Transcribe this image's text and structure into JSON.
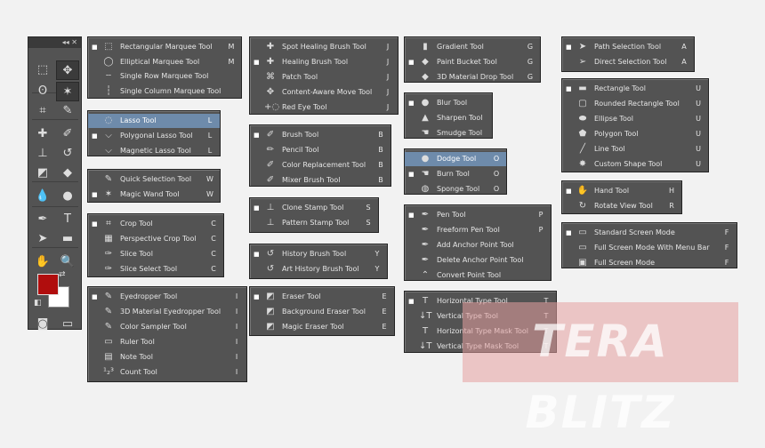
{
  "toolbar": {
    "header": "◂◂ ✕",
    "rows": [
      {
        "l": {
          "icon": "rect-marquee-icon",
          "glyph": "⬚"
        },
        "r": {
          "icon": "move-icon",
          "glyph": "✥",
          "active": true
        }
      },
      {
        "l": {
          "icon": "lasso-icon",
          "glyph": "ʘ"
        },
        "r": {
          "icon": "magic-wand-icon",
          "glyph": "✶",
          "active": true
        }
      },
      {
        "l": {
          "icon": "crop-icon",
          "glyph": "⌗"
        },
        "r": {
          "icon": "eyedropper-icon",
          "glyph": "✎"
        }
      },
      {
        "l": {
          "icon": "healing-brush-icon",
          "glyph": "✚"
        },
        "r": {
          "icon": "brush-icon",
          "glyph": "✐"
        }
      },
      {
        "l": {
          "icon": "clone-stamp-icon",
          "glyph": "⊥"
        },
        "r": {
          "icon": "history-brush-icon",
          "glyph": "↺"
        }
      },
      {
        "l": {
          "icon": "eraser-icon",
          "glyph": "◩"
        },
        "r": {
          "icon": "paint-bucket-icon",
          "glyph": "◆"
        }
      },
      {
        "l": {
          "icon": "blur-icon",
          "glyph": "💧"
        },
        "r": {
          "icon": "dodge-icon",
          "glyph": "●"
        }
      },
      {
        "l": {
          "icon": "pen-icon",
          "glyph": "✒"
        },
        "r": {
          "icon": "type-icon",
          "glyph": "T"
        }
      },
      {
        "l": {
          "icon": "path-selection-icon",
          "glyph": "➤"
        },
        "r": {
          "icon": "rectangle-shape-icon",
          "glyph": "▬"
        }
      },
      {
        "l": {
          "icon": "hand-icon",
          "glyph": "✋"
        },
        "r": {
          "icon": "zoom-icon",
          "glyph": "🔍"
        }
      }
    ],
    "bottom": {
      "l": {
        "icon": "quick-mask-icon",
        "glyph": "◙"
      },
      "r": {
        "icon": "screen-mode-icon",
        "glyph": "▭"
      }
    }
  },
  "menus": [
    {
      "id": "marquee",
      "items": [
        {
          "label": "Rectangular Marquee Tool",
          "key": "M",
          "icon": "rect-marquee-icon",
          "glyph": "⬚",
          "bullet": true
        },
        {
          "label": "Elliptical Marquee Tool",
          "key": "M",
          "icon": "ellipse-marquee-icon",
          "glyph": "◯"
        },
        {
          "label": "Single Row Marquee Tool",
          "key": "",
          "icon": "single-row-icon",
          "glyph": "┄"
        },
        {
          "label": "Single Column Marquee Tool",
          "key": "",
          "icon": "single-column-icon",
          "glyph": "┆"
        }
      ]
    },
    {
      "id": "lasso",
      "items": [
        {
          "label": "Lasso Tool",
          "key": "L",
          "icon": "lasso-icon",
          "glyph": "◌",
          "hl": true
        },
        {
          "label": "Polygonal Lasso Tool",
          "key": "L",
          "icon": "polygonal-lasso-icon",
          "glyph": "⌵",
          "bullet": true
        },
        {
          "label": "Magnetic Lasso Tool",
          "key": "L",
          "icon": "magnetic-lasso-icon",
          "glyph": "⌵"
        }
      ]
    },
    {
      "id": "quickselect",
      "items": [
        {
          "label": "Quick Selection Tool",
          "key": "W",
          "icon": "quick-selection-icon",
          "glyph": "✎"
        },
        {
          "label": "Magic Wand Tool",
          "key": "W",
          "icon": "magic-wand-icon",
          "glyph": "✶",
          "bullet": true
        }
      ]
    },
    {
      "id": "crop",
      "items": [
        {
          "label": "Crop Tool",
          "key": "C",
          "icon": "crop-icon",
          "glyph": "⌗",
          "bullet": true
        },
        {
          "label": "Perspective Crop Tool",
          "key": "C",
          "icon": "perspective-crop-icon",
          "glyph": "▦"
        },
        {
          "label": "Slice Tool",
          "key": "C",
          "icon": "slice-icon",
          "glyph": "✑"
        },
        {
          "label": "Slice Select Tool",
          "key": "C",
          "icon": "slice-select-icon",
          "glyph": "✑"
        }
      ]
    },
    {
      "id": "eyedropper",
      "items": [
        {
          "label": "Eyedropper Tool",
          "key": "I",
          "icon": "eyedropper-icon",
          "glyph": "✎",
          "bullet": true
        },
        {
          "label": "3D Material Eyedropper Tool",
          "key": "I",
          "icon": "3d-eyedropper-icon",
          "glyph": "✎"
        },
        {
          "label": "Color Sampler Tool",
          "key": "I",
          "icon": "color-sampler-icon",
          "glyph": "✎"
        },
        {
          "label": "Ruler Tool",
          "key": "I",
          "icon": "ruler-icon",
          "glyph": "▭"
        },
        {
          "label": "Note Tool",
          "key": "I",
          "icon": "note-icon",
          "glyph": "▤"
        },
        {
          "label": "Count Tool",
          "key": "I",
          "icon": "count-icon",
          "glyph": "¹₂³"
        }
      ]
    },
    {
      "id": "healing",
      "items": [
        {
          "label": "Spot Healing Brush Tool",
          "key": "J",
          "icon": "spot-healing-icon",
          "glyph": "✚"
        },
        {
          "label": "Healing Brush Tool",
          "key": "J",
          "icon": "healing-brush-icon",
          "glyph": "✚",
          "bullet": true
        },
        {
          "label": "Patch Tool",
          "key": "J",
          "icon": "patch-icon",
          "glyph": "⌘"
        },
        {
          "label": "Content-Aware Move Tool",
          "key": "J",
          "icon": "content-aware-move-icon",
          "glyph": "✥"
        },
        {
          "label": "Red Eye Tool",
          "key": "J",
          "icon": "red-eye-icon",
          "glyph": "+◌"
        }
      ]
    },
    {
      "id": "brush",
      "items": [
        {
          "label": "Brush Tool",
          "key": "B",
          "icon": "brush-icon",
          "glyph": "✐",
          "bullet": true
        },
        {
          "label": "Pencil Tool",
          "key": "B",
          "icon": "pencil-icon",
          "glyph": "✏"
        },
        {
          "label": "Color Replacement Tool",
          "key": "B",
          "icon": "color-replacement-icon",
          "glyph": "✐"
        },
        {
          "label": "Mixer Brush Tool",
          "key": "B",
          "icon": "mixer-brush-icon",
          "glyph": "✐"
        }
      ]
    },
    {
      "id": "stamp",
      "items": [
        {
          "label": "Clone Stamp Tool",
          "key": "S",
          "icon": "clone-stamp-icon",
          "glyph": "⊥",
          "bullet": true
        },
        {
          "label": "Pattern Stamp Tool",
          "key": "S",
          "icon": "pattern-stamp-icon",
          "glyph": "⊥"
        }
      ]
    },
    {
      "id": "history",
      "items": [
        {
          "label": "History Brush Tool",
          "key": "Y",
          "icon": "history-brush-icon",
          "glyph": "↺",
          "bullet": true
        },
        {
          "label": "Art History Brush Tool",
          "key": "Y",
          "icon": "art-history-brush-icon",
          "glyph": "↺"
        }
      ]
    },
    {
      "id": "eraser",
      "items": [
        {
          "label": "Eraser Tool",
          "key": "E",
          "icon": "eraser-icon",
          "glyph": "◩",
          "bullet": true
        },
        {
          "label": "Background Eraser Tool",
          "key": "E",
          "icon": "background-eraser-icon",
          "glyph": "◩"
        },
        {
          "label": "Magic Eraser Tool",
          "key": "E",
          "icon": "magic-eraser-icon",
          "glyph": "◩"
        }
      ]
    },
    {
      "id": "gradient",
      "items": [
        {
          "label": "Gradient Tool",
          "key": "G",
          "icon": "gradient-icon",
          "glyph": "▮"
        },
        {
          "label": "Paint Bucket Tool",
          "key": "G",
          "icon": "paint-bucket-icon",
          "glyph": "◆",
          "bullet": true
        },
        {
          "label": "3D Material Drop Tool",
          "key": "G",
          "icon": "3d-material-drop-icon",
          "glyph": "◆"
        }
      ]
    },
    {
      "id": "blur",
      "items": [
        {
          "label": "Blur Tool",
          "key": "",
          "icon": "blur-icon",
          "glyph": "●",
          "bullet": true
        },
        {
          "label": "Sharpen Tool",
          "key": "",
          "icon": "sharpen-icon",
          "glyph": "▲"
        },
        {
          "label": "Smudge Tool",
          "key": "",
          "icon": "smudge-icon",
          "glyph": "☚"
        }
      ]
    },
    {
      "id": "dodge",
      "items": [
        {
          "label": "Dodge Tool",
          "key": "O",
          "icon": "dodge-icon",
          "glyph": "●",
          "hl": true
        },
        {
          "label": "Burn Tool",
          "key": "O",
          "icon": "burn-icon",
          "glyph": "☚",
          "bullet": true
        },
        {
          "label": "Sponge Tool",
          "key": "O",
          "icon": "sponge-icon",
          "glyph": "◍"
        }
      ]
    },
    {
      "id": "pen",
      "items": [
        {
          "label": "Pen Tool",
          "key": "P",
          "icon": "pen-icon",
          "glyph": "✒",
          "bullet": true
        },
        {
          "label": "Freeform Pen Tool",
          "key": "P",
          "icon": "freeform-pen-icon",
          "glyph": "✒"
        },
        {
          "label": "Add Anchor Point Tool",
          "key": "",
          "icon": "add-anchor-icon",
          "glyph": "✒"
        },
        {
          "label": "Delete Anchor Point Tool",
          "key": "",
          "icon": "delete-anchor-icon",
          "glyph": "✒"
        },
        {
          "label": "Convert Point Tool",
          "key": "",
          "icon": "convert-point-icon",
          "glyph": "⌃"
        }
      ]
    },
    {
      "id": "type",
      "items": [
        {
          "label": "Horizontal Type Tool",
          "key": "T",
          "icon": "horizontal-type-icon",
          "glyph": "T",
          "bullet": true
        },
        {
          "label": "Vertical Type Tool",
          "key": "T",
          "icon": "vertical-type-icon",
          "glyph": "↓T"
        },
        {
          "label": "Horizontal Type Mask Tool",
          "key": "T",
          "icon": "horizontal-type-mask-icon",
          "glyph": "T"
        },
        {
          "label": "Vertical Type Mask Tool",
          "key": "T",
          "icon": "vertical-type-mask-icon",
          "glyph": "↓T"
        }
      ]
    },
    {
      "id": "pathsel",
      "items": [
        {
          "label": "Path Selection Tool",
          "key": "A",
          "icon": "path-selection-icon",
          "glyph": "➤",
          "bullet": true
        },
        {
          "label": "Direct Selection Tool",
          "key": "A",
          "icon": "direct-selection-icon",
          "glyph": "➢"
        }
      ]
    },
    {
      "id": "shape",
      "items": [
        {
          "label": "Rectangle Tool",
          "key": "U",
          "icon": "rectangle-icon",
          "glyph": "▬",
          "bullet": true
        },
        {
          "label": "Rounded Rectangle Tool",
          "key": "U",
          "icon": "rounded-rectangle-icon",
          "glyph": "▢"
        },
        {
          "label": "Ellipse Tool",
          "key": "U",
          "icon": "ellipse-icon",
          "glyph": "⬬"
        },
        {
          "label": "Polygon Tool",
          "key": "U",
          "icon": "polygon-icon",
          "glyph": "⬟"
        },
        {
          "label": "Line Tool",
          "key": "U",
          "icon": "line-icon",
          "glyph": "╱"
        },
        {
          "label": "Custom Shape Tool",
          "key": "U",
          "icon": "custom-shape-icon",
          "glyph": "✸"
        }
      ]
    },
    {
      "id": "hand",
      "items": [
        {
          "label": "Hand Tool",
          "key": "H",
          "icon": "hand-icon",
          "glyph": "✋",
          "bullet": true
        },
        {
          "label": "Rotate View Tool",
          "key": "R",
          "icon": "rotate-view-icon",
          "glyph": "↻"
        }
      ]
    },
    {
      "id": "screen",
      "items": [
        {
          "label": "Standard Screen Mode",
          "key": "F",
          "icon": "standard-screen-icon",
          "glyph": "▭",
          "bullet": true
        },
        {
          "label": "Full Screen Mode With Menu Bar",
          "key": "F",
          "icon": "full-screen-menu-icon",
          "glyph": "▭"
        },
        {
          "label": "Full Screen Mode",
          "key": "F",
          "icon": "full-screen-icon",
          "glyph": "▣"
        }
      ]
    }
  ],
  "watermark": "TERA BLITZ"
}
